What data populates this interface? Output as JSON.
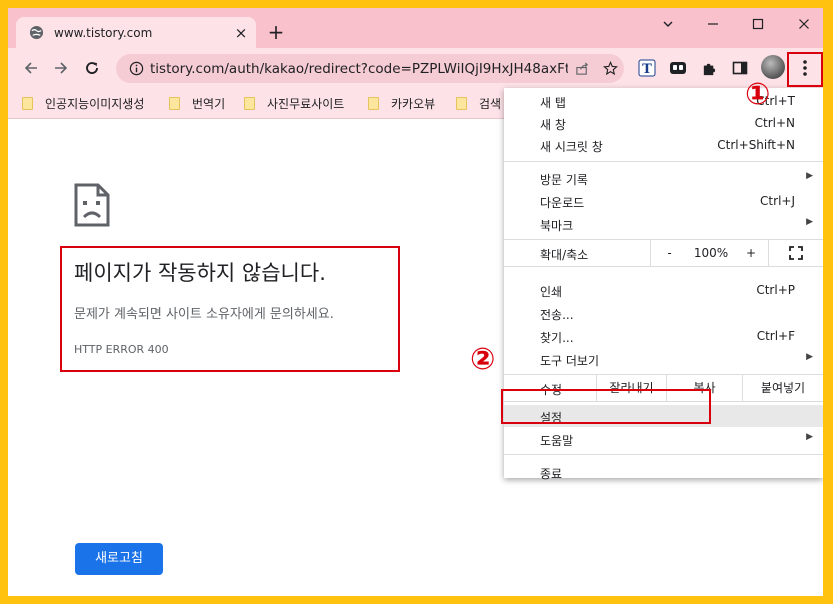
{
  "tab": {
    "favicon": "globe-icon",
    "title": "www.tistory.com",
    "close": "×"
  },
  "new_tab": "+",
  "window": {
    "minimize": "—",
    "maximize": "☐",
    "close": "✕",
    "tab_search": "⌄"
  },
  "toolbar": {
    "url": "tistory.com/auth/kakao/redirect?code=PZPLWiIQjI9HxJH48axFt..."
  },
  "bookmarks": [
    "인공지능이미지생성",
    "번역기",
    "사진무료사이트",
    "카카오뷰",
    "검색"
  ],
  "error_page": {
    "title": "페이지가 작동하지 않습니다.",
    "description": "문제가 계속되면 사이트 소유자에게 문의하세요.",
    "code": "HTTP ERROR 400",
    "reload": "새로고침"
  },
  "annotations": {
    "one": "①",
    "two": "②"
  },
  "menu": {
    "new_tab": "새 탭",
    "new_tab_short": "Ctrl+T",
    "new_window": "새 창",
    "new_window_short": "Ctrl+N",
    "incognito": "새 시크릿 창",
    "incognito_short": "Ctrl+Shift+N",
    "history": "방문 기록",
    "downloads": "다운로드",
    "downloads_short": "Ctrl+J",
    "bookmarks": "북마크",
    "zoom_label": "확대/축소",
    "zoom_minus": "-",
    "zoom_value": "100%",
    "zoom_plus": "+",
    "print": "인쇄",
    "print_short": "Ctrl+P",
    "cast": "전송...",
    "find": "찾기...",
    "find_short": "Ctrl+F",
    "more_tools": "도구 더보기",
    "edit_label": "수정",
    "cut": "잘라내기",
    "copy": "복사",
    "paste": "붙여넣기",
    "settings": "설정",
    "help": "도움말",
    "exit": "종료"
  },
  "colors": {
    "accent": "#1A73E8",
    "annotation": "#D9000D",
    "border": "#FFC20E",
    "tab_strip": "#F8C1CC"
  }
}
